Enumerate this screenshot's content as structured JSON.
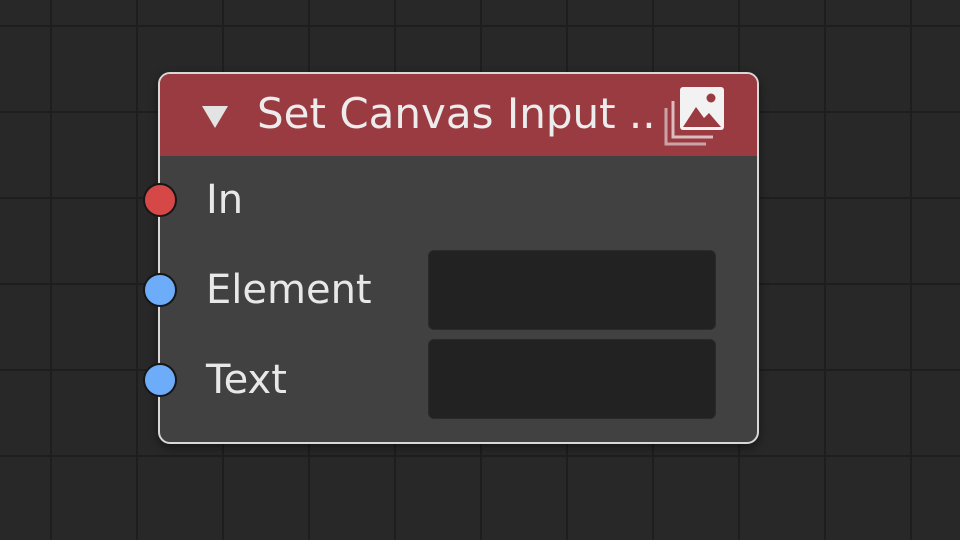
{
  "node": {
    "title": "Set Canvas Input ...",
    "header_color": "#9a3b42",
    "header_icon": "image-stack-icon",
    "collapse_icon": "triangle-down-icon",
    "sockets": [
      {
        "label": "In",
        "type": "exec",
        "color": "#d64848",
        "value": ""
      },
      {
        "label": "Element",
        "type": "value",
        "color": "#6cacf8",
        "value": ""
      },
      {
        "label": "Text",
        "type": "value",
        "color": "#6cacf8",
        "value": ""
      }
    ]
  }
}
